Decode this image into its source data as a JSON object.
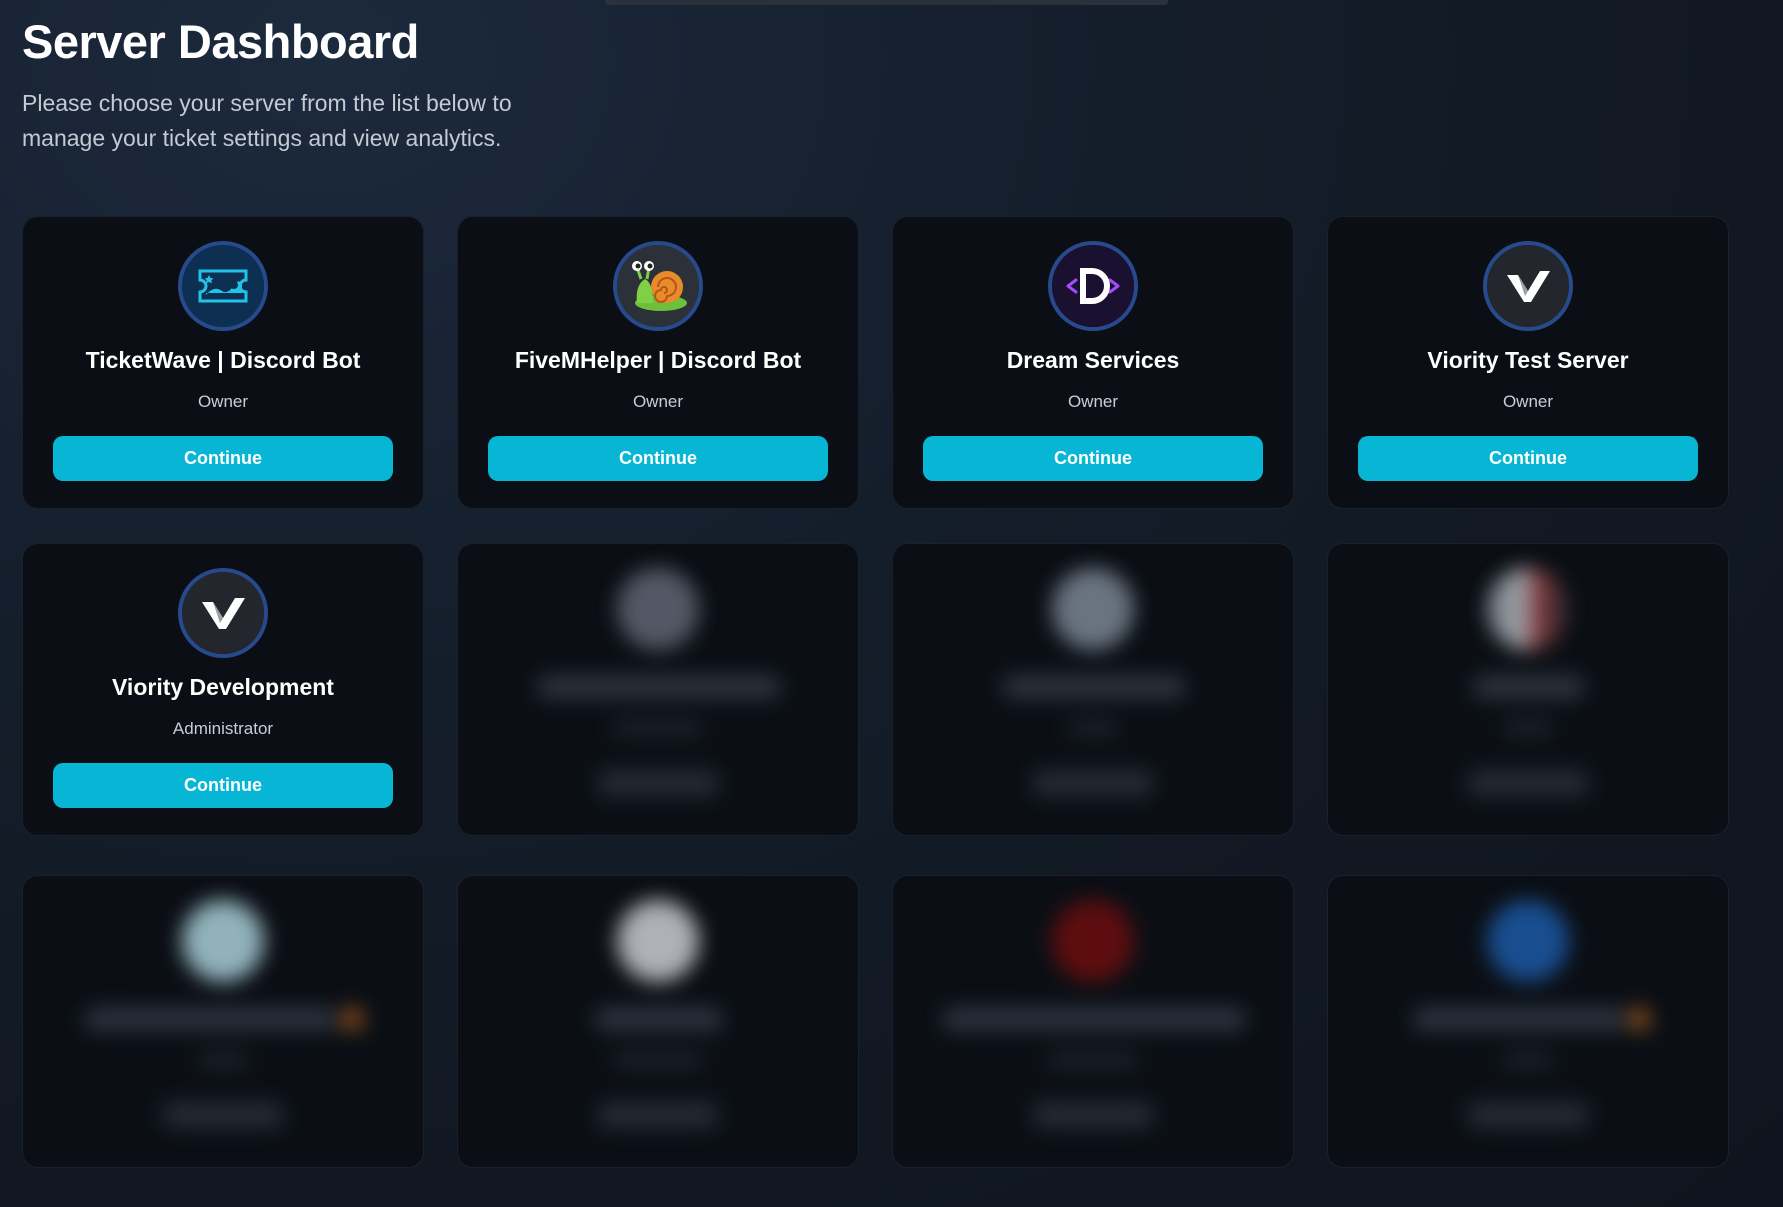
{
  "page": {
    "title": "Server Dashboard",
    "subtitle": "Please choose your server from the list below to manage your ticket settings and view analytics."
  },
  "servers": [
    {
      "name": "TicketWave | Discord Bot",
      "role": "Owner",
      "button": "Continue",
      "icon": "ticketwave-logo-icon"
    },
    {
      "name": "FiveMHelper | Discord Bot",
      "role": "Owner",
      "button": "Continue",
      "icon": "snail-icon"
    },
    {
      "name": "Dream Services",
      "role": "Owner",
      "button": "Continue",
      "icon": "dream-d-logo-icon"
    },
    {
      "name": "Viority Test Server",
      "role": "Owner",
      "button": "Continue",
      "icon": "viority-v-logo-icon"
    },
    {
      "name": "Viority Development",
      "role": "Administrator",
      "button": "Continue",
      "icon": "viority-v-logo-icon"
    }
  ],
  "locked_cards": [
    {
      "avatar_color": "#6b7280"
    },
    {
      "avatar_color": "#8a97a6"
    },
    {
      "avatar_color": "#b04848"
    },
    {
      "avatar_color": "#bfe9f3"
    },
    {
      "avatar_color": "#e5e7eb"
    },
    {
      "avatar_color": "#7a0d0d"
    },
    {
      "avatar_color": "#1d63b8"
    }
  ],
  "colors": {
    "accent": "#06b6d4",
    "avatar_ring": "#274a8c",
    "card_bg": "#0b0f15"
  }
}
